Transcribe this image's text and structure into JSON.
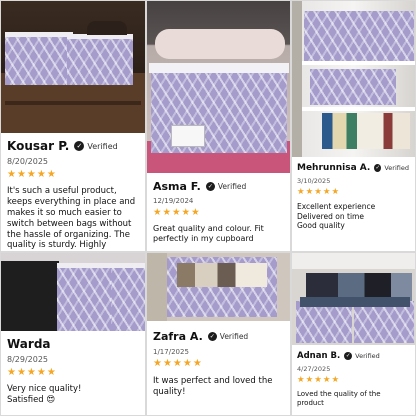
{
  "verified_label": "Verified",
  "check_glyph": "✓",
  "star_color": "#f5a623",
  "reviews": [
    {
      "name": "Kousar P.",
      "date": "8/20/2025",
      "stars": "★★★★★",
      "rating": 5,
      "text": "It's such a useful product, keeps everything in place and makes it so much easier to switch between bags without the hassle of organizing. The quality is sturdy. Highly recommended!"
    },
    {
      "name": "Asma F.",
      "date": "12/19/2024",
      "stars": "★★★★★",
      "rating": 5,
      "text": "Great quality and colour. Fit perfectly in my cupboard"
    },
    {
      "name": "Mehrunnisa A.",
      "date": "3/10/2025",
      "stars": "★★★★★",
      "rating": 5,
      "lines": [
        "Excellent experience",
        "Delivered on time",
        "Good quality"
      ]
    },
    {
      "name": "Warda",
      "date": "8/29/2025",
      "stars": "★★★★★",
      "rating": 5,
      "lines": [
        "Very nice quality!",
        "Satisfied 😍"
      ]
    },
    {
      "name": "Zafra A.",
      "date": "1/17/2025",
      "stars": "★★★★★",
      "rating": 5,
      "text": "It was perfect and loved the quality!"
    },
    {
      "name": "Adnan B.",
      "date": "4/27/2025",
      "stars": "★★★★★",
      "rating": 5,
      "text": "Loved the quality of the product"
    }
  ]
}
